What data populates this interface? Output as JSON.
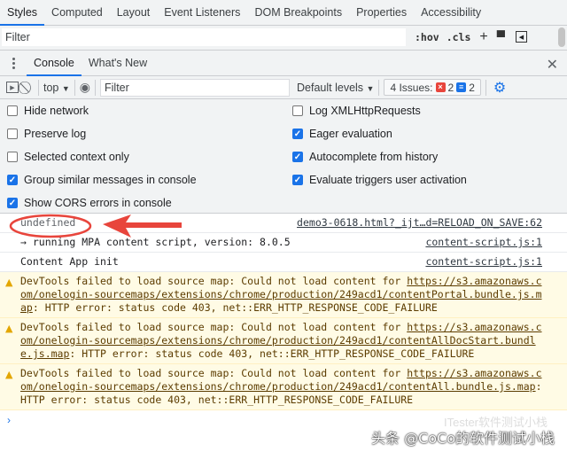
{
  "tabs": [
    "Styles",
    "Computed",
    "Layout",
    "Event Listeners",
    "DOM Breakpoints",
    "Properties",
    "Accessibility"
  ],
  "styles_filter": {
    "placeholder": "Filter",
    "hov": ":hov",
    "cls": ".cls"
  },
  "drawer": {
    "tabs": [
      "Console",
      "What's New"
    ]
  },
  "toolbar": {
    "context": "top",
    "filter_placeholder": "Filter",
    "levels": "Default levels",
    "issues_label": "4 Issues:",
    "errors": "2",
    "infos": "2"
  },
  "settings": {
    "left": [
      {
        "label": "Hide network",
        "checked": false
      },
      {
        "label": "Preserve log",
        "checked": false
      },
      {
        "label": "Selected context only",
        "checked": false
      },
      {
        "label": "Group similar messages in console",
        "checked": true
      },
      {
        "label": "Show CORS errors in console",
        "checked": true
      }
    ],
    "right": [
      {
        "label": "Log XMLHttpRequests",
        "checked": false
      },
      {
        "label": "Eager evaluation",
        "checked": true
      },
      {
        "label": "Autocomplete from history",
        "checked": true
      },
      {
        "label": "Evaluate triggers user activation",
        "checked": true
      }
    ]
  },
  "messages": [
    {
      "text": "undefined",
      "source": "demo3-0618.html?_ijt…d=RELOAD_ON_SAVE:62"
    },
    {
      "text": "→ running MPA content script, version: 8.0.5",
      "source": "content-script.js:1"
    },
    {
      "text": "Content App init",
      "source": "content-script.js:1"
    }
  ],
  "warnings": [
    {
      "prefix": "DevTools failed to load source map: Could not load content for ",
      "url": "https://s3.amazonaws.com/onelogin-sourcemaps/extensions/chrome/production/249acd1/contentPortal.bundle.js.map",
      "suffix": ": HTTP error: status code 403, net::ERR_HTTP_RESPONSE_CODE_FAILURE"
    },
    {
      "prefix": "DevTools failed to load source map: Could not load content for ",
      "url": "https://s3.amazonaws.com/onelogin-sourcemaps/extensions/chrome/production/249acd1/contentAllDocStart.bundle.js.map",
      "suffix": ": HTTP error: status code 403, net::ERR_HTTP_RESPONSE_CODE_FAILURE"
    },
    {
      "prefix": "DevTools failed to load source map: Could not load content for ",
      "url": "https://s3.amazonaws.com/onelogin-sourcemaps/extensions/chrome/production/249acd1/contentAll.bundle.js.map",
      "suffix": ": HTTP error: status code 403, net::ERR_HTTP_RESPONSE_CODE_FAILURE"
    }
  ],
  "prompt": "›",
  "watermark": "头条 @CoCo的软件测试小栈",
  "watermark2": "ITester软件测试小栈",
  "colors": {
    "accent": "#1a73e8",
    "annotation": "#e8453c",
    "warning_bg": "#fffbe5"
  }
}
